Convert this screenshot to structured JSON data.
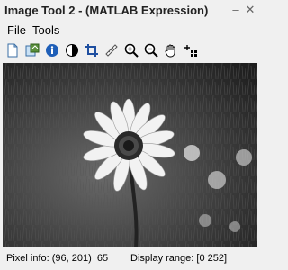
{
  "window": {
    "title": "Image Tool 2 - (MATLAB Expression)"
  },
  "menu": {
    "items": [
      "File",
      "Tools"
    ]
  },
  "toolbar": {
    "tools": [
      "new-figure-icon",
      "export-icon",
      "image-info-icon",
      "contrast-icon",
      "crop-icon",
      "measure-distance-icon",
      "zoom-in-icon",
      "zoom-out-icon",
      "pan-hand-icon",
      "pixel-region-icon"
    ]
  },
  "image": {
    "subject": "grayscale-flower-photo"
  },
  "status": {
    "pixel_info_label": "Pixel info:",
    "pixel_info_value": "(96, 201)  65",
    "display_range_label": "Display range:",
    "display_range_value": "[0 252]"
  },
  "colors": {
    "background": "#f0f0f0",
    "image_bg": "#3a3a3a"
  }
}
